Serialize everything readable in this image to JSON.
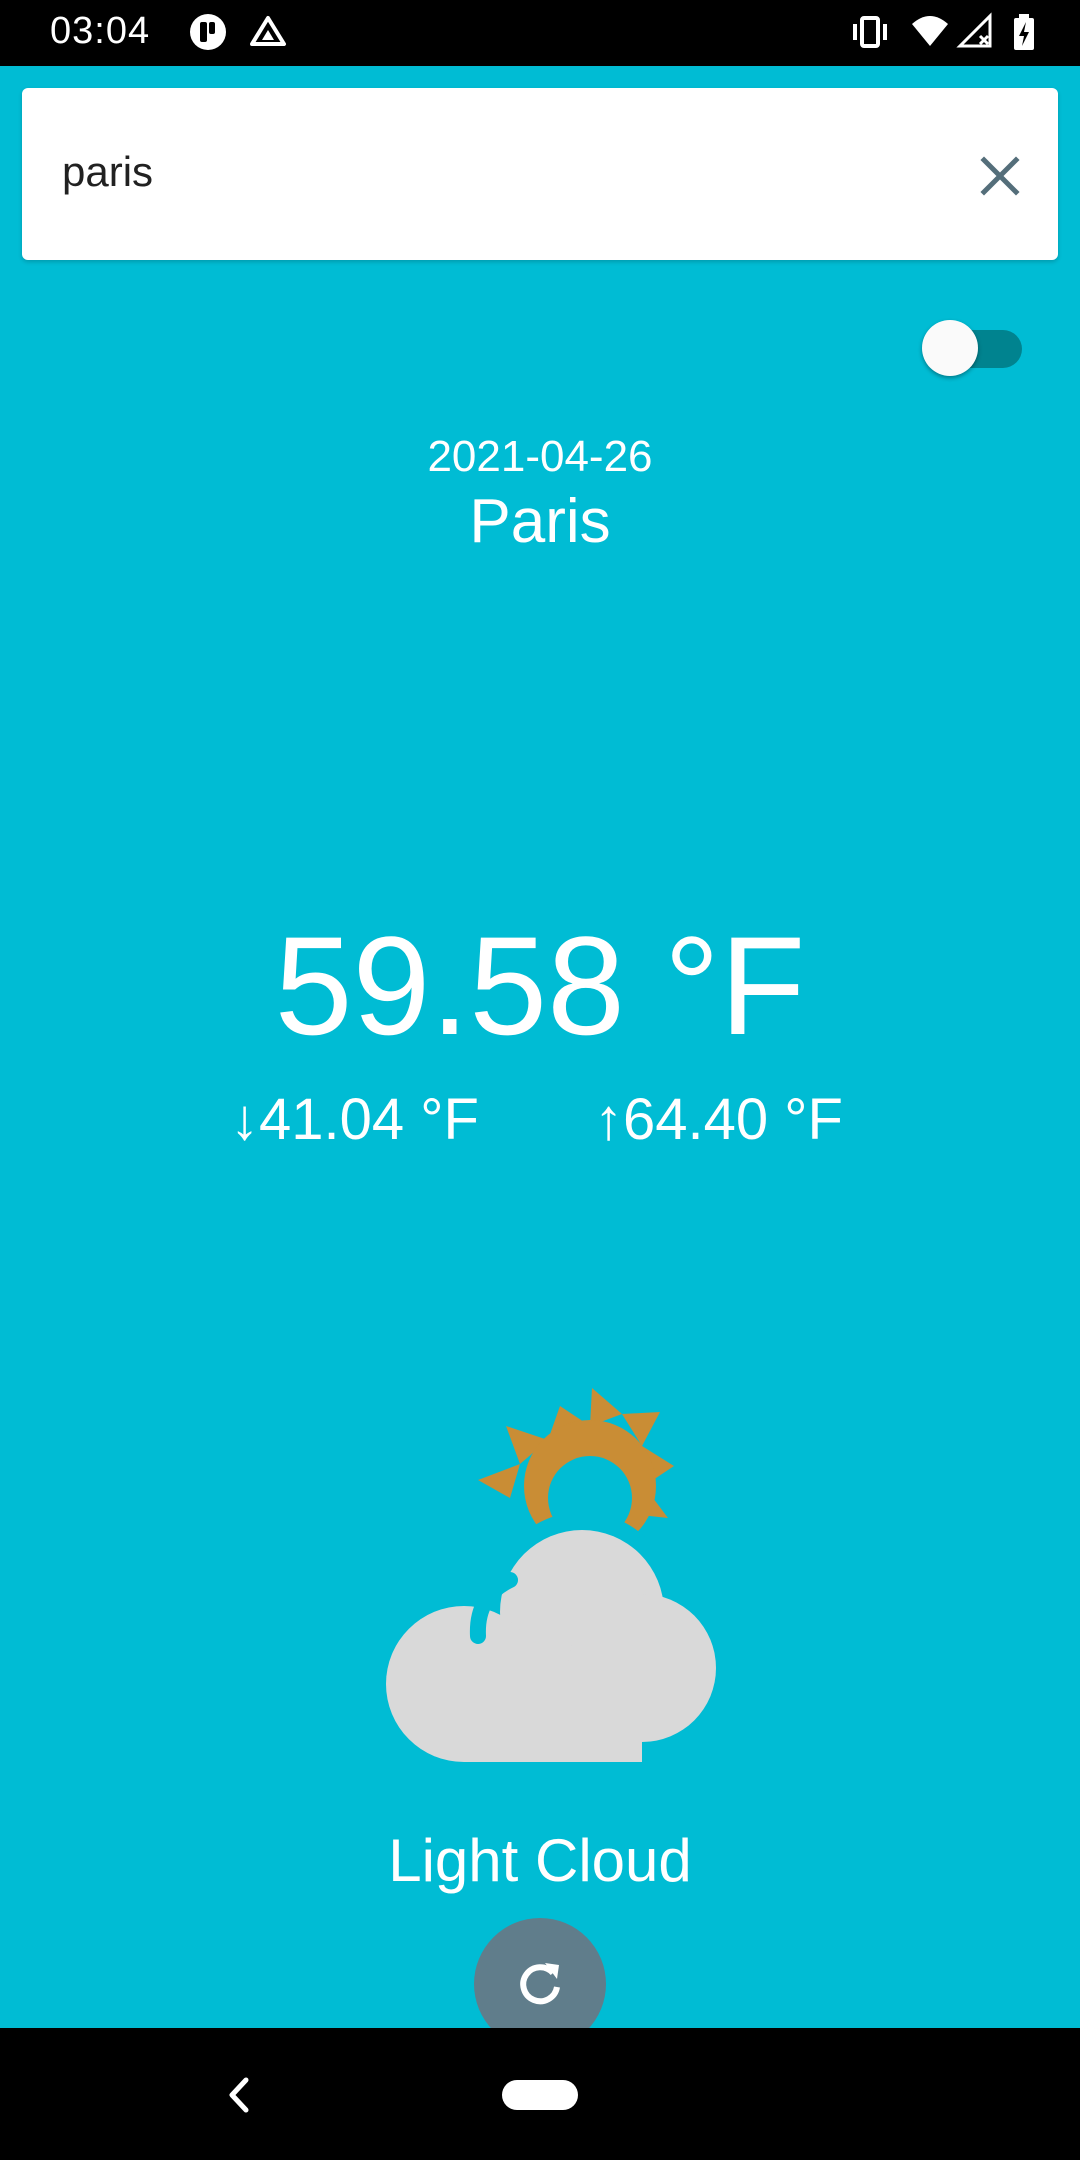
{
  "status_bar": {
    "time": "03:04",
    "icons": [
      "notification-app-icon",
      "drive-icon",
      "vibrate-icon",
      "wifi-icon",
      "signal-icon",
      "battery-icon"
    ]
  },
  "search": {
    "value": "paris",
    "clear_icon": "close-icon"
  },
  "units_toggle": {
    "on": true,
    "track_color": "#00838F",
    "thumb_color": "#FAFAFA"
  },
  "weather": {
    "date": "2021-04-26",
    "city": "Paris",
    "temperature": "59.58 °F",
    "temp_min": "↓41.04 °F",
    "temp_max": "↑64.40 °F",
    "condition": "Light Cloud",
    "condition_icon": "sun-behind-cloud-icon"
  },
  "refresh": {
    "icon": "refresh-icon",
    "color": "#607D8B"
  },
  "colors": {
    "background": "#00BCD4",
    "sun": "#C98D35",
    "cloud": "#D9D9D9"
  },
  "nav": {
    "back_icon": "back-icon",
    "home_icon": "home-pill-icon"
  }
}
